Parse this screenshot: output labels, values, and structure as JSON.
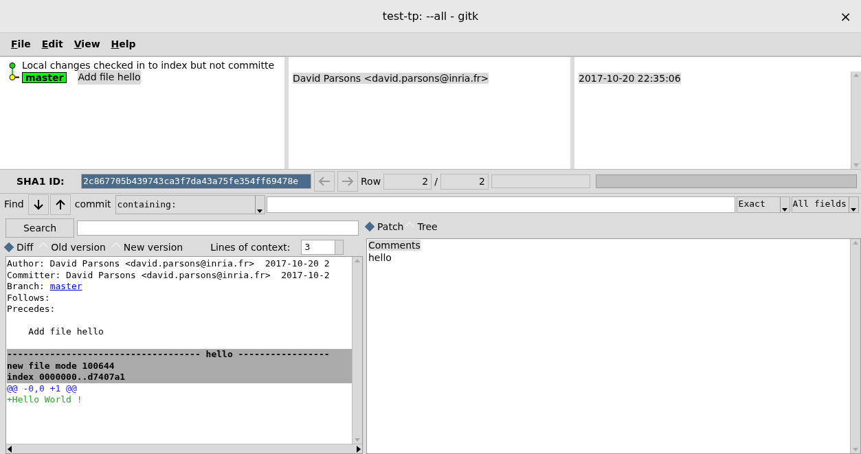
{
  "window": {
    "title": "test-tp: --all - gitk",
    "close": "×"
  },
  "menu": [
    "File",
    "Edit",
    "View",
    "Help"
  ],
  "commits": [
    {
      "kind": "local",
      "subject": "Local changes checked in to index but not committe",
      "selected": false
    },
    {
      "kind": "commit",
      "branch": "master",
      "subject": "Add file hello",
      "author": "David Parsons <david.parsons@inria.fr>",
      "date": "2017-10-20 22:35:06",
      "selected": true
    }
  ],
  "sha": {
    "label": "SHA1 ID:",
    "value": "2c867705b439743ca3f7da43a75fe354ff69478e",
    "row_label": "Row",
    "row": "2",
    "row_sep": "/",
    "row_total": "2"
  },
  "find": {
    "label": "Find",
    "type_label": "commit",
    "mode": "containing:",
    "match": "Exact",
    "fields": "All fields"
  },
  "search": {
    "button": "Search"
  },
  "progress": {
    "level": 0
  },
  "view_modes": [
    {
      "label": "Diff",
      "selected": true
    },
    {
      "label": "Old version",
      "selected": false
    },
    {
      "label": "New version",
      "selected": false
    }
  ],
  "context": {
    "label": "Lines of context:",
    "value": "3"
  },
  "file_modes": [
    {
      "label": "Patch",
      "selected": true
    },
    {
      "label": "Tree",
      "selected": false
    }
  ],
  "diff": [
    {
      "kind": "text",
      "text": "Author: David Parsons <david.parsons@inria.fr>  2017-10-20 2"
    },
    {
      "kind": "text",
      "text": "Committer: David Parsons <david.parsons@inria.fr>  2017-10-2"
    },
    {
      "kind": "branch",
      "text": "Branch: ",
      "link": "master"
    },
    {
      "kind": "text",
      "text": "Follows:"
    },
    {
      "kind": "text",
      "text": "Precedes:"
    },
    {
      "kind": "message",
      "text": "    Add file hello"
    },
    {
      "kind": "header",
      "text": "------------------------------------ hello -----------------"
    },
    {
      "kind": "header",
      "text": "new file mode 100644"
    },
    {
      "kind": "header",
      "text": "index 0000000..d7407a1"
    },
    {
      "kind": "hunk",
      "text": "@@ -0,0 +1 @@"
    },
    {
      "kind": "add",
      "text": "+Hello World !"
    }
  ],
  "files": [
    {
      "label": "Comments",
      "selected": true
    },
    {
      "label": "hello",
      "selected": false
    }
  ]
}
